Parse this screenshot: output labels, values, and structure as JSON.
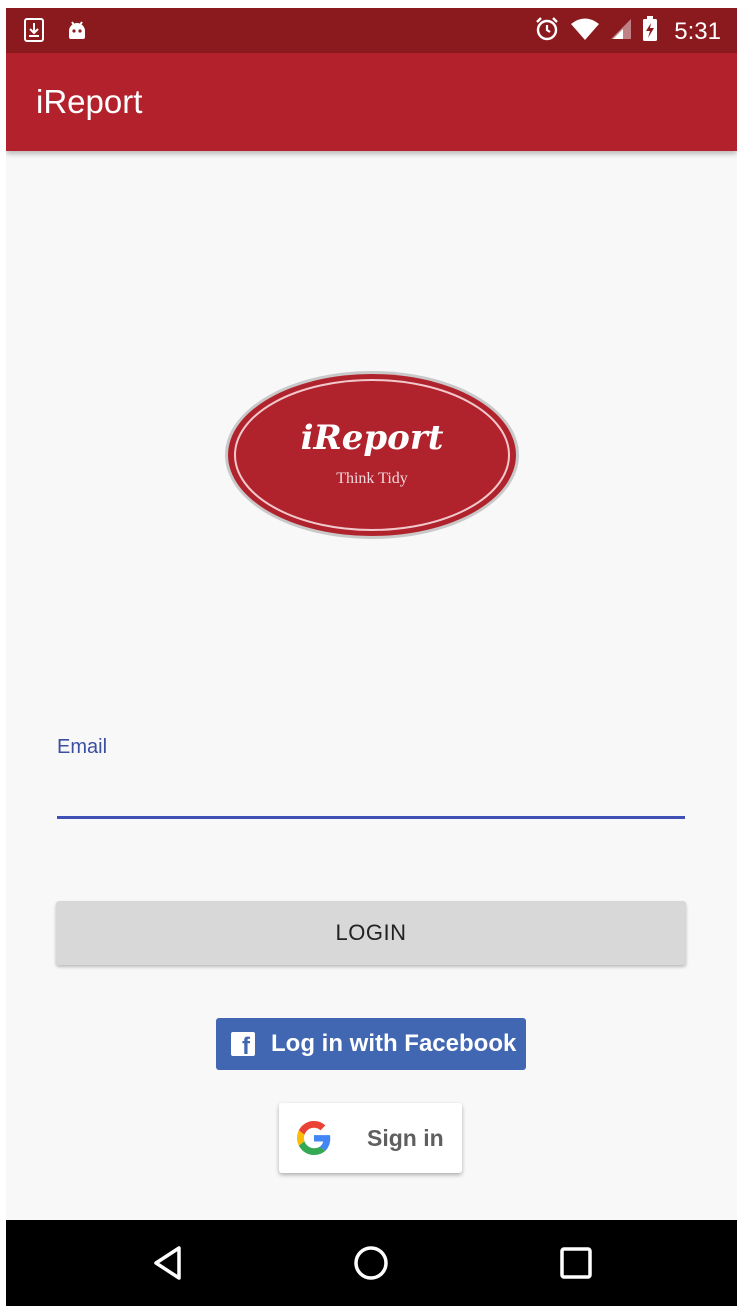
{
  "status_bar": {
    "time": "5:31",
    "icons": [
      "download-icon",
      "android-icon",
      "alarm-icon",
      "wifi-icon",
      "signal-icon",
      "battery-charging-icon"
    ]
  },
  "app_bar": {
    "title": "iReport"
  },
  "logo": {
    "name": "iReport",
    "tagline": "Think Tidy"
  },
  "email_field": {
    "label": "Email",
    "value": "",
    "placeholder": ""
  },
  "login_button": {
    "label": "LOGIN"
  },
  "facebook_button": {
    "label": "Log in with Facebook",
    "icon": "facebook-icon"
  },
  "google_button": {
    "label": "Sign in",
    "icon": "google-icon"
  },
  "nav_bar": {
    "buttons": [
      "back-icon",
      "home-icon",
      "recents-icon"
    ]
  },
  "colors": {
    "status_bar": "#8b1a1e",
    "app_bar": "#b3212d",
    "accent": "#3f51b5",
    "facebook": "#4267b2",
    "background": "#f8f8f8"
  }
}
